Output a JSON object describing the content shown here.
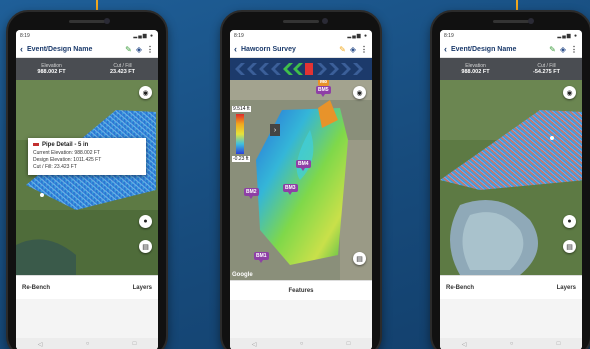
{
  "phones": [
    {
      "status_time": "8:19",
      "title": "Event/Design Name",
      "elevation_label": "Elevation",
      "elevation_value": "988.002 FT",
      "cutfill_label": "Cut / Fill",
      "cutfill_value": "23.423 FT",
      "popup": {
        "title": "Pipe Detail - 5 in",
        "current_elevation": "Current Elevation: 988.002 FT",
        "design_elevation": "Design Elevation: 1011.425 FT",
        "cut_fill": "Cut / Fill: 23.423 FT"
      },
      "bottom_left": "Re-Bench",
      "bottom_right": "Layers"
    },
    {
      "status_time": "8:19",
      "title": "Hawcorn Survey",
      "scale_max": "9.514 ft",
      "scale_min": "-0.23 ft",
      "markers": [
        "M8",
        "BM5",
        "BM4",
        "BM3",
        "BM2",
        "BM1"
      ],
      "google_label": "Google",
      "bottom_center": "Features"
    },
    {
      "status_time": "8:19",
      "title": "Event/Design Name",
      "elevation_label": "Elevation",
      "elevation_value": "988.002 FT",
      "cutfill_label": "Cut / Fill",
      "cutfill_value": "-54.275 FT",
      "bottom_left": "Re-Bench",
      "bottom_right": "Layers"
    }
  ],
  "icons": {
    "back": "‹",
    "pencil": "✎",
    "layers": "◈",
    "more": "⋮",
    "locate": "◉",
    "chat": "▤",
    "collapse": "›",
    "nav_back": "◁",
    "nav_home": "○",
    "nav_recent": "□"
  },
  "colors": {
    "background": "#1a5186",
    "accent_orange": "#f2a81d",
    "marker_purple": "#8e3fa6",
    "header_dark": "#4a4d52"
  }
}
